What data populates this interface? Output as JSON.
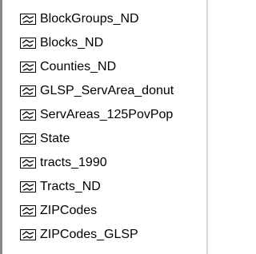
{
  "layers": [
    {
      "label": "BlockGroups_ND"
    },
    {
      "label": "Blocks_ND"
    },
    {
      "label": "Counties_ND"
    },
    {
      "label": "GLSP_ServArea_donut"
    },
    {
      "label": "ServAreas_125PovPop"
    },
    {
      "label": "State"
    },
    {
      "label": "tracts_1990"
    },
    {
      "label": "Tracts_ND"
    },
    {
      "label": "ZIPCodes"
    },
    {
      "label": "ZIPCodes_GLSP"
    }
  ],
  "icon": "polygon-feature-class-icon"
}
